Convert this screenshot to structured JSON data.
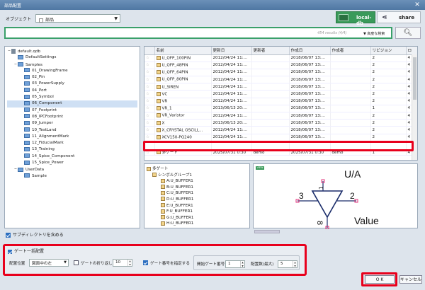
{
  "window": {
    "title": "部品配置",
    "close_glyph": "✕"
  },
  "object_selector": {
    "label": "オブジェクト",
    "value": "部品"
  },
  "db": {
    "label": "local-db"
  },
  "share": {
    "label": "share"
  },
  "search": {
    "value": "",
    "results": "454 results (4/4)",
    "advanced_label": "▼ 高度な検索"
  },
  "tree": {
    "items": [
      {
        "label": "default.qdb",
        "level": 0,
        "type": "db",
        "expander": "−"
      },
      {
        "label": "DefaultSettings",
        "level": 1,
        "type": "folder",
        "expander": ""
      },
      {
        "label": "Samples",
        "level": 1,
        "type": "folder",
        "expander": "−"
      },
      {
        "label": "01_DrawingFrame",
        "level": 2,
        "type": "folder",
        "expander": ""
      },
      {
        "label": "02_Pin",
        "level": 2,
        "type": "folder",
        "expander": ""
      },
      {
        "label": "03_PowerSupply",
        "level": 2,
        "type": "folder",
        "expander": ""
      },
      {
        "label": "04_Port",
        "level": 2,
        "type": "folder",
        "expander": ""
      },
      {
        "label": "05_Symbol",
        "level": 2,
        "type": "folder",
        "expander": ""
      },
      {
        "label": "06_Component",
        "level": 2,
        "type": "folder",
        "expander": "",
        "selected": true
      },
      {
        "label": "07_Footprint",
        "level": 2,
        "type": "folder",
        "expander": ""
      },
      {
        "label": "08_IPCFootprint",
        "level": 2,
        "type": "folder",
        "expander": ""
      },
      {
        "label": "09_Jumper",
        "level": 2,
        "type": "folder",
        "expander": ""
      },
      {
        "label": "10_TestLand",
        "level": 2,
        "type": "folder",
        "expander": ""
      },
      {
        "label": "11_AlignmentMark",
        "level": 2,
        "type": "folder",
        "expander": ""
      },
      {
        "label": "12_FiducialMark",
        "level": 2,
        "type": "folder",
        "expander": ""
      },
      {
        "label": "13_Training",
        "level": 2,
        "type": "folder",
        "expander": ""
      },
      {
        "label": "14_Spice_Component",
        "level": 2,
        "type": "folder",
        "expander": ""
      },
      {
        "label": "15_Spice_Power",
        "level": 2,
        "type": "folder",
        "expander": ""
      },
      {
        "label": "UserData",
        "level": 1,
        "type": "folder",
        "expander": "−"
      },
      {
        "label": "Sample",
        "level": 2,
        "type": "folder",
        "expander": ""
      }
    ],
    "include_subdirs_label": "サブディレクトリを含める"
  },
  "grid": {
    "columns": [
      "",
      "名前",
      "更新日",
      "更新者",
      "作成日",
      "作成者",
      "リビジョン",
      "ロ"
    ],
    "rows": [
      [
        "☆",
        "U_QFP_100PIN",
        "2012/04/24 11:...",
        "",
        "2018/06/07 13:...",
        "",
        "2",
        "4"
      ],
      [
        "☆",
        "U_QFP_48PIN",
        "2012/04/24 11:...",
        "",
        "2018/06/07 13:...",
        "",
        "2",
        "4"
      ],
      [
        "☆",
        "U_QFP_64PIN",
        "2012/04/24 11:...",
        "",
        "2018/06/07 13:...",
        "",
        "2",
        "4"
      ],
      [
        "☆",
        "U_QFP_80PIN",
        "2012/04/24 11:...",
        "",
        "2018/06/07 13:...",
        "",
        "2",
        "4"
      ],
      [
        "☆",
        "U_SIREN",
        "2012/04/24 11:...",
        "",
        "2018/06/07 13:...",
        "",
        "2",
        "4"
      ],
      [
        "☆",
        "VC",
        "2012/04/24 11:...",
        "",
        "2018/06/07 13:...",
        "",
        "2",
        "4"
      ],
      [
        "☆",
        "VR",
        "2012/04/24 11:...",
        "",
        "2018/06/07 13:...",
        "",
        "2",
        "4"
      ],
      [
        "☆",
        "VR_1",
        "2013/06/13 20:...",
        "",
        "2018/06/07 13:...",
        "",
        "1",
        "4"
      ],
      [
        "☆",
        "VR_Varistor",
        "2012/04/24 11:...",
        "",
        "2018/06/07 13:...",
        "",
        "2",
        "4"
      ],
      [
        "☆",
        "X",
        "2013/06/13 20:...",
        "",
        "2018/06/07 13:...",
        "",
        "2",
        "4"
      ],
      [
        "☆",
        "X_CRYSTAL OSCILL...",
        "2012/04/24 11:...",
        "",
        "2018/06/07 13:...",
        "",
        "2",
        "4"
      ],
      [
        "☆",
        "XCV150-PQ240",
        "2012/04/24 11:...",
        "",
        "2018/06/07 13:...",
        "",
        "2",
        "4"
      ],
      [
        "☆",
        "多ゲート",
        "2025/07/31 0:30",
        "demo",
        "2025/07/31 0:30",
        "demo",
        "1",
        "4"
      ]
    ]
  },
  "symbol_tree": {
    "root": "多ゲート",
    "group": "シンボルグループ1",
    "items": [
      "A:U_BUFFER1",
      "B:U_BUFFER1",
      "C:U_BUFFER1",
      "D:U_BUFFER1",
      "E:U_BUFFER1",
      "F:U_BUFFER1",
      "G:U_BUFFER1",
      "H:U_BUFFER1"
    ]
  },
  "preview": {
    "view_tag": "VIEW",
    "ref": "U/A",
    "value": "Value",
    "pin_in": "3",
    "pin_out": "2",
    "pin_top": "1",
    "pin_bottom": "8"
  },
  "gate": {
    "header": "ゲート一括配置",
    "placement_label": "配置位置",
    "placement_value": "図面中の左",
    "wrap_label": "ゲートの折り返し",
    "wrap_value": "10",
    "specify_label": "ゲート番号を指定する",
    "start_label": "開始ゲート番号",
    "start_value": "1",
    "max_label": "配置数(最大)",
    "max_value": "5"
  },
  "buttons": {
    "ok": "O K",
    "cancel": "キャンセル"
  },
  "colors": {
    "accent": "#3a9a5a",
    "highlight": "#e8001c",
    "title": "#4f77a3"
  }
}
